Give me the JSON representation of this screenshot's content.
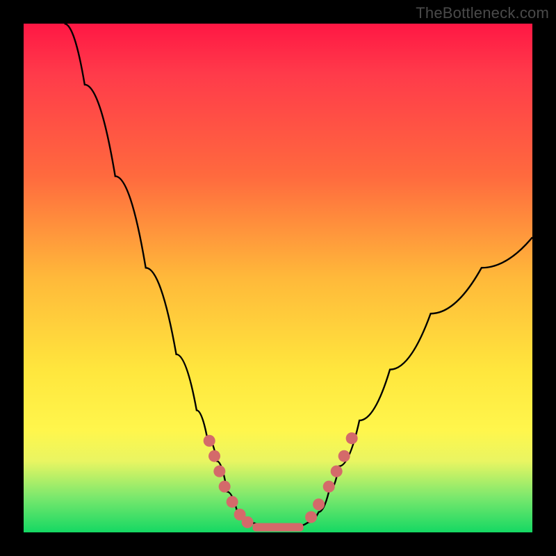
{
  "watermark": "TheBottleneck.com",
  "chart_data": {
    "type": "line",
    "title": "",
    "xlabel": "",
    "ylabel": "",
    "xlim": [
      0,
      100
    ],
    "ylim": [
      0,
      100
    ],
    "series": [
      {
        "name": "curve",
        "x": [
          8,
          12,
          18,
          24,
          30,
          34,
          36,
          38,
          40,
          42,
          44,
          47,
          50,
          53,
          56,
          58,
          60,
          62,
          66,
          72,
          80,
          90,
          100
        ],
        "y": [
          100,
          88,
          70,
          52,
          35,
          24,
          19,
          14,
          8,
          4,
          2,
          1,
          1,
          1,
          2,
          4,
          8,
          13,
          22,
          32,
          43,
          52,
          58
        ]
      }
    ],
    "markers_left": {
      "name": "dots-left",
      "x": [
        36.5,
        37.5,
        38.5,
        39.5,
        41.0,
        42.5,
        44.0
      ],
      "y": [
        18.0,
        15.0,
        12.0,
        9.0,
        6.0,
        3.5,
        2.0
      ]
    },
    "markers_right": {
      "name": "dots-right",
      "x": [
        56.5,
        58.0,
        60.0,
        61.5,
        63.0,
        64.5
      ],
      "y": [
        3.0,
        5.5,
        9.0,
        12.0,
        15.0,
        18.5
      ]
    },
    "flat_bar": {
      "name": "line-bottom",
      "x0": 45,
      "x1": 55,
      "y": 1
    },
    "colors": {
      "curve": "#000000",
      "marker_fill": "#d46a6a",
      "marker_stroke": "#c94f4f"
    }
  }
}
